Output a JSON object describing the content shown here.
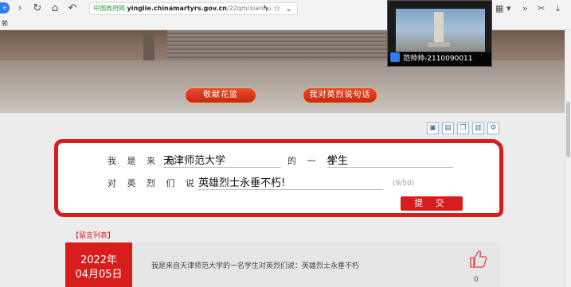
{
  "browser": {
    "tab_badge": "e",
    "secure_label": "中国政府网",
    "url_host": "yinglie.chinamartyrs.gov.cn",
    "url_path": "/22qm/xianhu",
    "bookmark_hint": "赖"
  },
  "hero": {
    "offer_flowers_label": "敬献花篮",
    "say_to_martyrs_label": "我对英烈说句话"
  },
  "video": {
    "caption": "范帅帅-2110090011"
  },
  "form": {
    "from_label": "我 是 来 自",
    "school_value": "天津师范大学",
    "identity_label": "的 一 名",
    "identity_value": "学生",
    "say_label": "对 英 烈 们 说 ：",
    "message_value": "英雄烈士永垂不朽!",
    "counter": "(9/50)",
    "submit_label": "提 交"
  },
  "messages": {
    "list_label": "【留言列表】",
    "items": [
      {
        "year": "2022年",
        "date": "04月05日",
        "text": "我是来自天津师范大学的一名学生对英烈们说：英雄烈士永垂不朽",
        "likes": "0"
      }
    ]
  },
  "colors": {
    "accent_red": "#d81d1d",
    "link_blue": "#2f7ee8"
  }
}
